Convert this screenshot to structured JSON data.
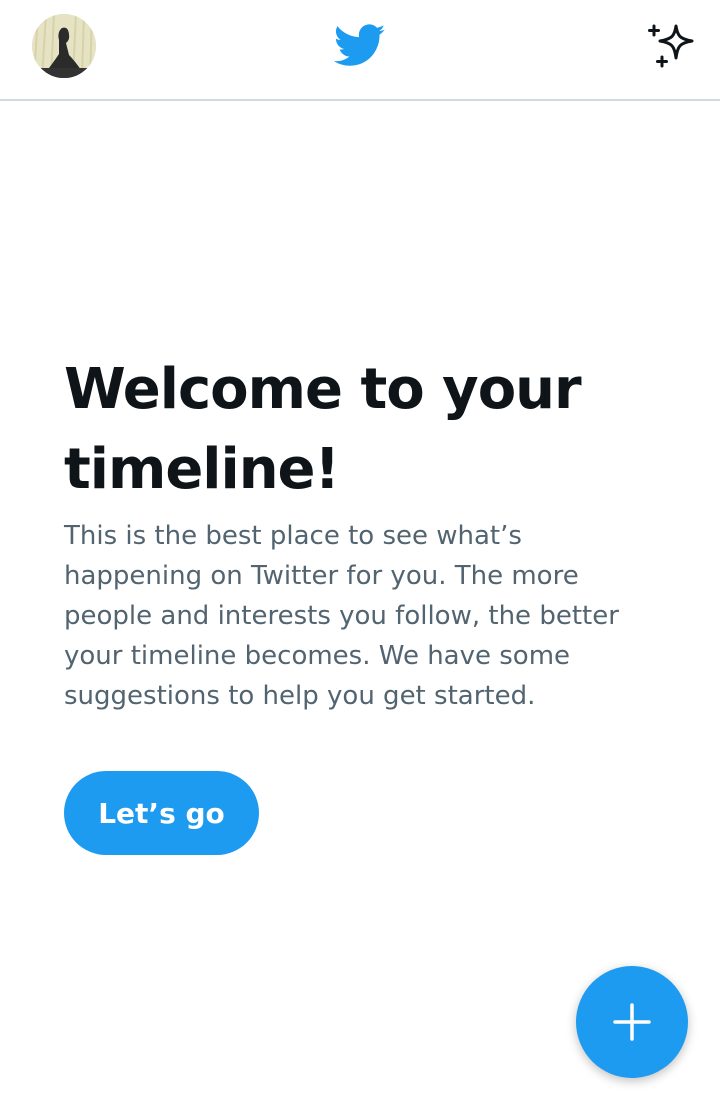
{
  "header": {
    "avatar_icon": "profile-avatar",
    "logo_icon": "twitter-bird-icon",
    "logo_color": "#1d9bf0",
    "sparkle_icon": "sparkle-icon"
  },
  "welcome": {
    "title": "Welcome to your timeline!",
    "body": "This is the best place to see what’s happening on Twitter for you. The more people and interests you follow, the better your timeline becomes. We have some suggestions to help you get started.",
    "cta_label": "Let’s go"
  },
  "compose_button": {
    "icon": "plus-icon"
  },
  "colors": {
    "accent": "#1d9bf0",
    "text_primary": "#0f1419",
    "text_secondary": "#536471",
    "divider": "#cfd9de"
  }
}
